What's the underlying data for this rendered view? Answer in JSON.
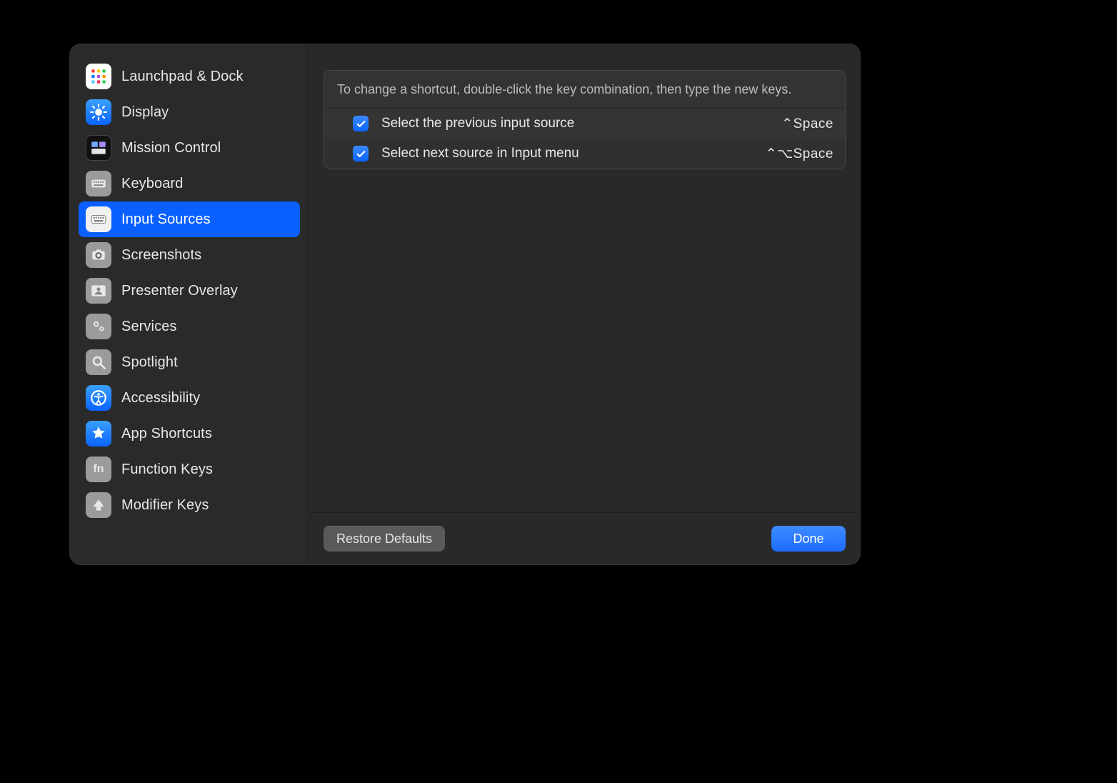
{
  "sidebar": {
    "items": [
      {
        "id": "launchpad",
        "label": "Launchpad & Dock",
        "icon": "launchpad-icon",
        "selected": false
      },
      {
        "id": "display",
        "label": "Display",
        "icon": "display-icon",
        "selected": false
      },
      {
        "id": "mission",
        "label": "Mission Control",
        "icon": "mission-icon",
        "selected": false
      },
      {
        "id": "keyboard",
        "label": "Keyboard",
        "icon": "keyboard-icon",
        "selected": false
      },
      {
        "id": "input",
        "label": "Input Sources",
        "icon": "input-icon",
        "selected": true
      },
      {
        "id": "screenshots",
        "label": "Screenshots",
        "icon": "screenshots-icon",
        "selected": false
      },
      {
        "id": "presenter",
        "label": "Presenter Overlay",
        "icon": "presenter-icon",
        "selected": false
      },
      {
        "id": "services",
        "label": "Services",
        "icon": "services-icon",
        "selected": false
      },
      {
        "id": "spotlight",
        "label": "Spotlight",
        "icon": "spotlight-icon",
        "selected": false
      },
      {
        "id": "accessibility",
        "label": "Accessibility",
        "icon": "accessibility-icon",
        "selected": false
      },
      {
        "id": "appshortcuts",
        "label": "App Shortcuts",
        "icon": "appshortcuts-icon",
        "selected": false
      },
      {
        "id": "functionkeys",
        "label": "Function Keys",
        "icon": "functionkeys-icon",
        "selected": false
      },
      {
        "id": "modifierkeys",
        "label": "Modifier Keys",
        "icon": "modifierkeys-icon",
        "selected": false
      }
    ]
  },
  "main": {
    "instruction": "To change a shortcut, double-click the key combination, then type the new keys.",
    "rows": [
      {
        "checked": true,
        "label": "Select the previous input source",
        "shortcut": "⌃Space"
      },
      {
        "checked": true,
        "label": "Select next source in Input menu",
        "shortcut": "⌃⌥Space"
      }
    ]
  },
  "footer": {
    "restore_label": "Restore Defaults",
    "done_label": "Done"
  },
  "colors": {
    "selection": "#0a60ff",
    "button_primary": "#2b77ff",
    "button_secondary": "#5a5a5a"
  }
}
